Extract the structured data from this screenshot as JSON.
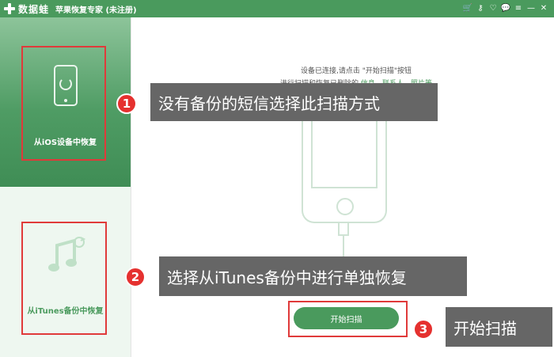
{
  "titlebar": {
    "logo_text": "数据蛙",
    "app_title": "苹果恢复专家 (未注册)",
    "icons": [
      "cart-icon",
      "key-icon",
      "heart-icon",
      "chat-icon",
      "menu-icon",
      "minimize-icon",
      "close-icon"
    ],
    "icon_glyphs": [
      "🛒",
      "⚷",
      "♡",
      "💬",
      "≡",
      "—",
      "✕"
    ]
  },
  "sidebar": {
    "items": [
      {
        "label": "从iOS设备中恢复",
        "icon": "phone-sync-icon"
      },
      {
        "label": "从iTunes备份中恢复",
        "icon": "music-note-icon"
      }
    ]
  },
  "main": {
    "instruction_line1": "设备已连接,请点击 \"开始扫描\"按钮",
    "instruction_line2_prefix": "进行扫描和恢复已删除的",
    "instruction_links": [
      "信息",
      "联系人",
      "照片等"
    ],
    "scan_button_label": "开始扫描"
  },
  "annotations": {
    "callouts": [
      {
        "number": "1",
        "text": "没有备份的短信选择此扫描方式"
      },
      {
        "number": "2",
        "text": "选择从iTunes备份中进行单独恢复"
      },
      {
        "number": "3",
        "text": "开始扫描"
      }
    ]
  },
  "colors": {
    "brand_green": "#4a9a5d",
    "highlight_red": "#e03a3a",
    "callout_gray": "#666666",
    "badge_red": "#e5312f"
  }
}
